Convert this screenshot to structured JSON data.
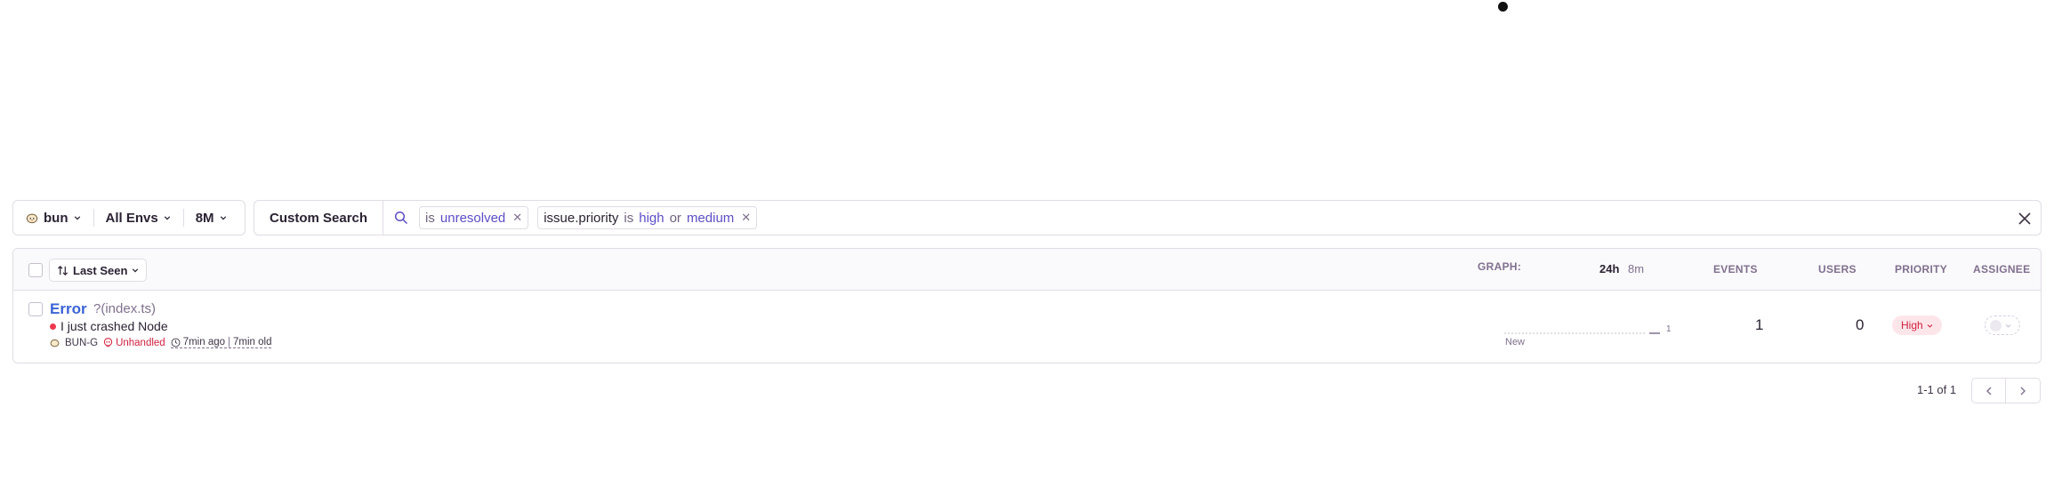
{
  "page_filters": {
    "project": "bun",
    "environment": "All Envs",
    "date_range": "8M"
  },
  "search": {
    "custom_search_label": "Custom Search",
    "tokens": [
      {
        "key": "",
        "op": "is",
        "values": [
          "unresolved"
        ]
      },
      {
        "key": "issue.priority",
        "op": "is",
        "values": [
          "high",
          "or",
          "medium"
        ]
      }
    ]
  },
  "issue_list": {
    "sort_label": "Last Seen",
    "columns": {
      "graph": "GRAPH:",
      "period_24h": "24h",
      "period_8m": "8m",
      "events": "EVENTS",
      "users": "USERS",
      "priority": "PRIORITY",
      "assignee": "ASSIGNEE"
    },
    "rows": [
      {
        "type": "Error",
        "culprit": "?(index.ts)",
        "message": "I just crashed Node",
        "short_id": "BUN-G",
        "mechanism": "Unhandled",
        "last_seen": "7min ago",
        "first_seen": "7min old",
        "graph_new_label": "New",
        "graph_max": "1",
        "events": "1",
        "users": "0",
        "priority": "High"
      }
    ]
  },
  "pagination": {
    "caption": "1-1 of 1"
  },
  "colors": {
    "link": "#3a63d6",
    "error": "#d1213f",
    "token_value": "#5b4ec6",
    "priority_bg": "#fde6ea"
  }
}
